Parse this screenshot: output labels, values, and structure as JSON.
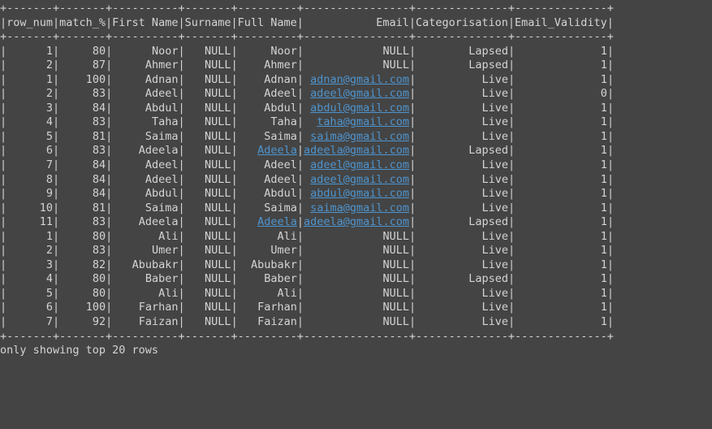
{
  "columns": [
    {
      "name": "row_num",
      "width": 7
    },
    {
      "name": "match_%",
      "width": 7
    },
    {
      "name": "First Name",
      "width": 10
    },
    {
      "name": "Surname",
      "width": 7
    },
    {
      "name": "Full Name",
      "width": 9
    },
    {
      "name": "Email",
      "width": 16
    },
    {
      "name": "Categorisation",
      "width": 14
    },
    {
      "name": "Email_Validity",
      "width": 14
    }
  ],
  "rows": [
    {
      "row_num": "1",
      "match_%": "80",
      "First Name": "Noor",
      "Surname": "NULL",
      "Full Name": "Noor",
      "Email": "NULL",
      "Email_link": false,
      "FullName_link": false,
      "Categorisation": "Lapsed",
      "Email_Validity": "1"
    },
    {
      "row_num": "2",
      "match_%": "87",
      "First Name": "Ahmer",
      "Surname": "NULL",
      "Full Name": "Ahmer",
      "Email": "NULL",
      "Email_link": false,
      "FullName_link": false,
      "Categorisation": "Lapsed",
      "Email_Validity": "1"
    },
    {
      "row_num": "1",
      "match_%": "100",
      "First Name": "Adnan",
      "Surname": "NULL",
      "Full Name": "Adnan",
      "Email": "adnan@gmail.com",
      "Email_link": true,
      "FullName_link": false,
      "Categorisation": "Live",
      "Email_Validity": "1"
    },
    {
      "row_num": "2",
      "match_%": "83",
      "First Name": "Adeel",
      "Surname": "NULL",
      "Full Name": "Adeel",
      "Email": "adeel@gmail.com",
      "Email_link": true,
      "FullName_link": false,
      "Categorisation": "Live",
      "Email_Validity": "0"
    },
    {
      "row_num": "3",
      "match_%": "84",
      "First Name": "Abdul",
      "Surname": "NULL",
      "Full Name": "Abdul",
      "Email": "abdul@gmail.com",
      "Email_link": true,
      "FullName_link": false,
      "Categorisation": "Live",
      "Email_Validity": "1"
    },
    {
      "row_num": "4",
      "match_%": "83",
      "First Name": "Taha",
      "Surname": "NULL",
      "Full Name": "Taha",
      "Email": "taha@gmail.com",
      "Email_link": true,
      "FullName_link": false,
      "Categorisation": "Live",
      "Email_Validity": "1"
    },
    {
      "row_num": "5",
      "match_%": "81",
      "First Name": "Saima",
      "Surname": "NULL",
      "Full Name": "Saima",
      "Email": "saima@gmail.com",
      "Email_link": true,
      "FullName_link": false,
      "Categorisation": "Live",
      "Email_Validity": "1"
    },
    {
      "row_num": "6",
      "match_%": "83",
      "First Name": "Adeela",
      "Surname": "NULL",
      "Full Name": "Adeela",
      "Email": "adeela@gmail.com",
      "Email_link": true,
      "FullName_link": true,
      "Categorisation": "Lapsed",
      "Email_Validity": "1"
    },
    {
      "row_num": "7",
      "match_%": "84",
      "First Name": "Adeel",
      "Surname": "NULL",
      "Full Name": "Adeel",
      "Email": "adeel@gmail.com",
      "Email_link": true,
      "FullName_link": false,
      "Categorisation": "Live",
      "Email_Validity": "1"
    },
    {
      "row_num": "8",
      "match_%": "84",
      "First Name": "Adeel",
      "Surname": "NULL",
      "Full Name": "Adeel",
      "Email": "adeel@gmail.com",
      "Email_link": true,
      "FullName_link": false,
      "Categorisation": "Live",
      "Email_Validity": "1"
    },
    {
      "row_num": "9",
      "match_%": "84",
      "First Name": "Abdul",
      "Surname": "NULL",
      "Full Name": "Abdul",
      "Email": "abdul@gmail.com",
      "Email_link": true,
      "FullName_link": false,
      "Categorisation": "Live",
      "Email_Validity": "1"
    },
    {
      "row_num": "10",
      "match_%": "81",
      "First Name": "Saima",
      "Surname": "NULL",
      "Full Name": "Saima",
      "Email": "saima@gmail.com",
      "Email_link": true,
      "FullName_link": false,
      "Categorisation": "Live",
      "Email_Validity": "1"
    },
    {
      "row_num": "11",
      "match_%": "83",
      "First Name": "Adeela",
      "Surname": "NULL",
      "Full Name": "Adeela",
      "Email": "adeela@gmail.com",
      "Email_link": true,
      "FullName_link": true,
      "Categorisation": "Lapsed",
      "Email_Validity": "1"
    },
    {
      "row_num": "1",
      "match_%": "80",
      "First Name": "Ali",
      "Surname": "NULL",
      "Full Name": "Ali",
      "Email": "NULL",
      "Email_link": false,
      "FullName_link": false,
      "Categorisation": "Live",
      "Email_Validity": "1"
    },
    {
      "row_num": "2",
      "match_%": "83",
      "First Name": "Umer",
      "Surname": "NULL",
      "Full Name": "Umer",
      "Email": "NULL",
      "Email_link": false,
      "FullName_link": false,
      "Categorisation": "Live",
      "Email_Validity": "1"
    },
    {
      "row_num": "3",
      "match_%": "82",
      "First Name": "Abubakr",
      "Surname": "NULL",
      "Full Name": "Abubakr",
      "Email": "NULL",
      "Email_link": false,
      "FullName_link": false,
      "Categorisation": "Live",
      "Email_Validity": "1"
    },
    {
      "row_num": "4",
      "match_%": "80",
      "First Name": "Baber",
      "Surname": "NULL",
      "Full Name": "Baber",
      "Email": "NULL",
      "Email_link": false,
      "FullName_link": false,
      "Categorisation": "Lapsed",
      "Email_Validity": "1"
    },
    {
      "row_num": "5",
      "match_%": "80",
      "First Name": "Ali",
      "Surname": "NULL",
      "Full Name": "Ali",
      "Email": "NULL",
      "Email_link": false,
      "FullName_link": false,
      "Categorisation": "Live",
      "Email_Validity": "1"
    },
    {
      "row_num": "6",
      "match_%": "100",
      "First Name": "Farhan",
      "Surname": "NULL",
      "Full Name": "Farhan",
      "Email": "NULL",
      "Email_link": false,
      "FullName_link": false,
      "Categorisation": "Live",
      "Email_Validity": "1"
    },
    {
      "row_num": "7",
      "match_%": "92",
      "First Name": "Faizan",
      "Surname": "NULL",
      "Full Name": "Faizan",
      "Email": "NULL",
      "Email_link": false,
      "FullName_link": false,
      "Categorisation": "Live",
      "Email_Validity": "1"
    }
  ],
  "footer": "only showing top 20 rows"
}
